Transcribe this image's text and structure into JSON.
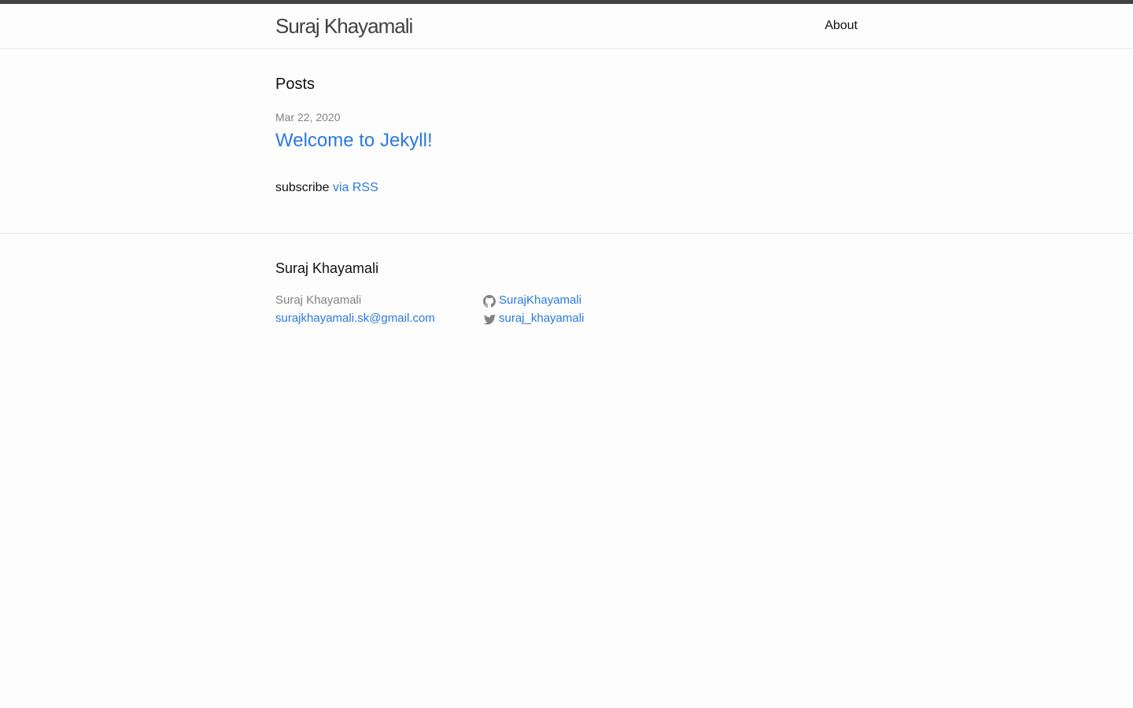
{
  "header": {
    "site_title": "Suraj Khayamali",
    "nav": [
      {
        "label": "About"
      }
    ]
  },
  "main": {
    "posts_heading": "Posts",
    "posts": [
      {
        "date": "Mar 22, 2020",
        "title": "Welcome to Jekyll!"
      }
    ],
    "subscribe_text": "subscribe",
    "rss_link": "via RSS"
  },
  "footer": {
    "heading": "Suraj Khayamali",
    "name": "Suraj Khayamali",
    "email": "surajkhayamali.sk@gmail.com",
    "social": [
      {
        "icon": "github-icon",
        "label": "SurajKhayamali"
      },
      {
        "icon": "twitter-icon",
        "label": "suraj_khayamali"
      }
    ]
  },
  "colors": {
    "accent": "#2a7ae2",
    "top_bar": "#424242",
    "muted": "#828282",
    "background": "#fdfdfd"
  }
}
